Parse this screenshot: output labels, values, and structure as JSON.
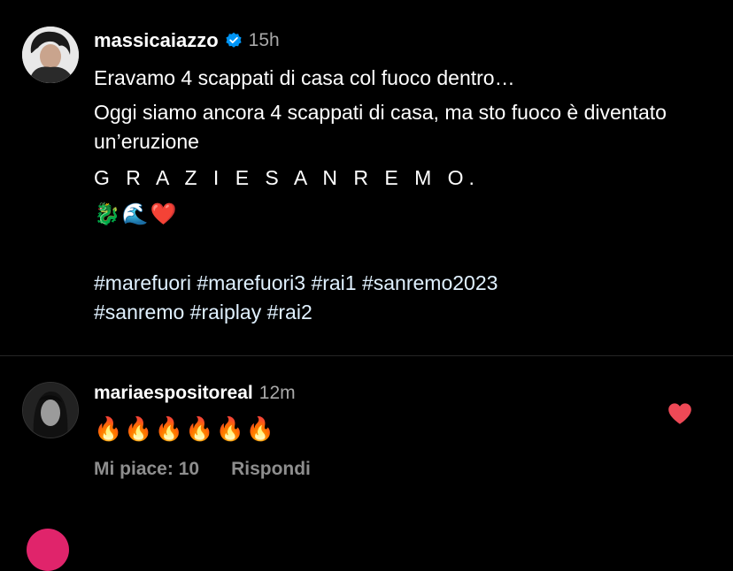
{
  "post": {
    "username": "massicaiazzo",
    "time": "15h",
    "caption": {
      "line1": "Eravamo 4 scappati di casa col fuoco dentro…",
      "line2": "Oggi siamo ancora 4 scappati di casa, ma sto fuoco è diventato un’eruzione",
      "line3": "G R A Z I E  S A N R E M O.",
      "emoji": "🐉🌊❤️",
      "hashtags_line1": "#marefuori #marefuori3 #rai1 #sanremo2023",
      "hashtags_line2": "#sanremo  #raiplay #rai2"
    }
  },
  "comment": {
    "username": "mariaespositoreal",
    "time": "12m",
    "text": "🔥🔥🔥🔥🔥🔥",
    "likes_label": "Mi piace: 10",
    "reply_label": "Rispondi"
  },
  "colors": {
    "background": "#000000",
    "verified": "#0095f6",
    "like_heart": "#ed4956",
    "secondary_text": "#a8a8a8"
  },
  "icons": {
    "verified": "verified-badge-icon",
    "like": "heart-filled-icon"
  }
}
